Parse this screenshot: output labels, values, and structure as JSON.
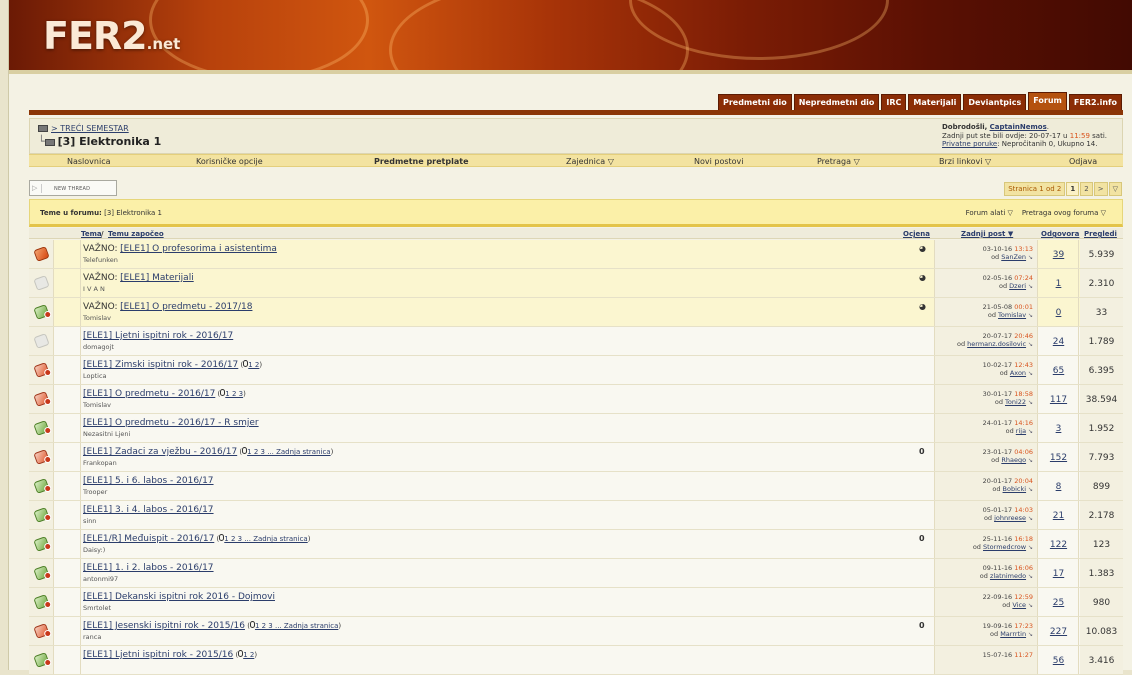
{
  "header": {
    "logo_main": "FER2",
    "logo_suffix": ".net"
  },
  "tabs": [
    "Predmetni dio",
    "Nepredmetni dio",
    "IRC",
    "Materijali",
    "Deviantpics",
    "Forum",
    "FER2.info"
  ],
  "active_tab": "Forum",
  "breadcrumb": {
    "parent": "> TREĆI SEMESTAR",
    "current": "[3] Elektronika 1"
  },
  "welcome": {
    "line1_prefix": "Dobrodošli,",
    "user": "CaptainNemos",
    "line2": "Zadnji put ste bili ovdje: 20-07-17 u ",
    "line2_time": "11:59",
    "line2_suffix": " sati.",
    "pm_link": "Privatne poruke",
    "pm_text": ": Nepročitanih 0, Ukupno 14."
  },
  "nav": [
    "Naslovnica",
    "Korisničke opcije",
    "Predmetne pretplate",
    "Zajednica",
    "Novi postovi",
    "Pretraga",
    "Brzi linkovi",
    "Odjava"
  ],
  "new_thread_label": "NEW THREAD",
  "pager": {
    "label": "Stranica 1 od 2",
    "pages": [
      "1",
      "2"
    ],
    "next": ">"
  },
  "list_header": {
    "title_prefix": "Teme u forumu:",
    "title": "[3] Elektronika 1",
    "tools": "Forum alati",
    "search": "Pretraga ovog foruma"
  },
  "columns": {
    "thread": "Tema",
    "starter": "Temu započeo",
    "rating": "Ocjena",
    "last_post": "Zadnji post",
    "replies": "Odgovora",
    "views": "Pregledi"
  },
  "threads": [
    {
      "prefix": "VAŽNO:",
      "title": "[ELE1] O profesorima i asistentima",
      "author": "Telefunken",
      "pages": "",
      "date": "03-10-16",
      "time": "13:13",
      "by": "SanZen",
      "replies": "39",
      "views": "5.939",
      "icon": "sticky-red",
      "sticky": true,
      "rated": true,
      "attach": false
    },
    {
      "prefix": "VAŽNO:",
      "title": "[ELE1] Materijali",
      "author": "I V A N",
      "pages": "",
      "date": "02-05-16",
      "time": "07:24",
      "by": "Dzeri",
      "replies": "1",
      "views": "2.310",
      "icon": "grey",
      "sticky": true,
      "rated": true,
      "attach": false
    },
    {
      "prefix": "VAŽNO:",
      "title": "[ELE1] O predmetu - 2017/18",
      "author": "Tomislav",
      "pages": "",
      "date": "21-05-08",
      "time": "00:01",
      "by": "Tomislav",
      "replies": "0",
      "views": "33",
      "icon": "green",
      "sticky": true,
      "rated": true,
      "attach": false
    },
    {
      "prefix": "",
      "title": "[ELE1] Ljetni ispitni rok - 2016/17",
      "author": "domagojt",
      "pages": "",
      "date": "20-07-17",
      "time": "20:46",
      "by": "hermanz.dosilovic",
      "replies": "24",
      "views": "1.789",
      "icon": "grey",
      "sticky": false,
      "rated": false,
      "attach": false
    },
    {
      "prefix": "",
      "title": "[ELE1] Zimski ispitni rok - 2016/17",
      "author": "Loptica",
      "pages": "1 2",
      "date": "10-02-17",
      "time": "12:43",
      "by": "Axon",
      "replies": "65",
      "views": "6.395",
      "icon": "red",
      "sticky": false,
      "rated": false,
      "attach": false
    },
    {
      "prefix": "",
      "title": "[ELE1] O predmetu - 2016/17",
      "author": "Tomislav",
      "pages": "1 2 3",
      "date": "30-01-17",
      "time": "18:58",
      "by": "Toni22",
      "replies": "117",
      "views": "38.594",
      "icon": "red",
      "sticky": false,
      "rated": false,
      "attach": false
    },
    {
      "prefix": "",
      "title": "[ELE1] O predmetu - 2016/17 - R smjer",
      "author": "Nezasitni Ljeni",
      "pages": "",
      "date": "24-01-17",
      "time": "14:16",
      "by": "rija",
      "replies": "3",
      "views": "1.952",
      "icon": "green",
      "sticky": false,
      "rated": false,
      "attach": false
    },
    {
      "prefix": "",
      "title": "[ELE1] Zadaci za vježbu - 2016/17",
      "author": "Frankopan",
      "pages": "1 2 3 ... Zadnja stranica",
      "date": "23-01-17",
      "time": "04:06",
      "by": "Rhaego",
      "replies": "152",
      "views": "7.793",
      "icon": "red",
      "sticky": false,
      "rated": false,
      "attach": true
    },
    {
      "prefix": "",
      "title": "[ELE1] 5. i 6. labos - 2016/17",
      "author": "Trooper",
      "pages": "",
      "date": "20-01-17",
      "time": "20:04",
      "by": "Bobicki",
      "replies": "8",
      "views": "899",
      "icon": "green",
      "sticky": false,
      "rated": false,
      "attach": false
    },
    {
      "prefix": "",
      "title": "[ELE1] 3. i 4. labos - 2016/17",
      "author": "sinn",
      "pages": "",
      "date": "05-01-17",
      "time": "14:03",
      "by": "johnreese",
      "replies": "21",
      "views": "2.178",
      "icon": "green",
      "sticky": false,
      "rated": false,
      "attach": false
    },
    {
      "prefix": "",
      "title": "[ELE1/R] Međuispit - 2016/17",
      "author": "Daisy:)",
      "pages": "1 2 3 ... Zadnja stranica",
      "date": "25-11-16",
      "time": "16:18",
      "by": "Stormedcrow",
      "replies": "122",
      "views": "123",
      "icon": "green",
      "sticky": false,
      "rated": false,
      "attach": true
    },
    {
      "prefix": "",
      "title": "[ELE1] 1. i 2. labos - 2016/17",
      "author": "antonmi97",
      "pages": "",
      "date": "09-11-16",
      "time": "16:06",
      "by": "zlatnimedo",
      "replies": "17",
      "views": "1.383",
      "icon": "green",
      "sticky": false,
      "rated": false,
      "attach": false
    },
    {
      "prefix": "",
      "title": "[ELE1] Dekanski ispitni rok 2016 - Dojmovi",
      "author": "Smrtolet",
      "pages": "",
      "date": "22-09-16",
      "time": "12:59",
      "by": "Vice",
      "replies": "25",
      "views": "980",
      "icon": "green",
      "sticky": false,
      "rated": false,
      "attach": false
    },
    {
      "prefix": "",
      "title": "[ELE1] Jesenski ispitni rok - 2015/16",
      "author": "ranca",
      "pages": "1 2 3 ... Zadnja stranica",
      "date": "19-09-16",
      "time": "17:23",
      "by": "Marrrtin",
      "replies": "227",
      "views": "10.083",
      "icon": "red",
      "sticky": false,
      "rated": false,
      "attach": true
    },
    {
      "prefix": "",
      "title": "[ELE1] Ljetni ispitni rok - 2015/16",
      "author": "",
      "pages": "1 2",
      "date": "15-07-16",
      "time": "11:27",
      "by": "",
      "replies": "56",
      "views": "3.416",
      "icon": "green",
      "sticky": false,
      "rated": false,
      "attach": false
    }
  ]
}
